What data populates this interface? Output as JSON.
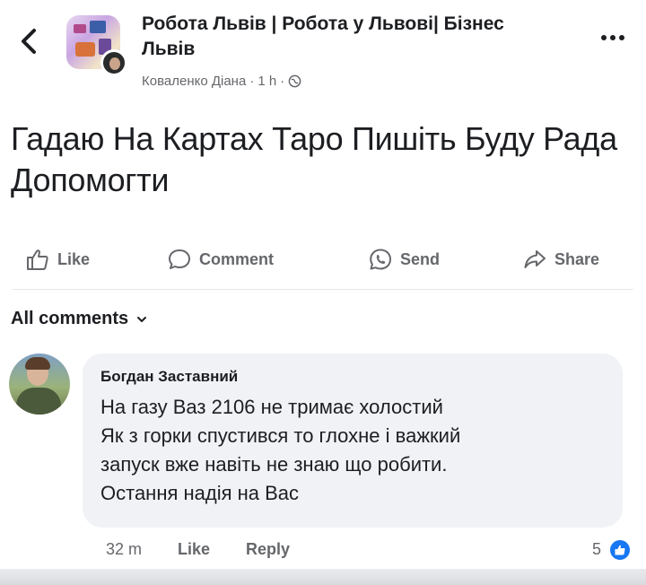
{
  "header": {
    "back_icon": "chevron-left-icon",
    "group_name": "Робота Львів | Робота у Львові| Бізнес Львів",
    "author": "Коваленко Діана",
    "separator": "·",
    "time": "1 h",
    "privacy_icon": "globe-icon",
    "more_icon": "more-horizontal-icon"
  },
  "post": {
    "text": "Гадаю На Картах Таро Пишіть Буду Рада Допомогти"
  },
  "actions": {
    "like_label": "Like",
    "comment_label": "Comment",
    "send_label": "Send",
    "share_label": "Share"
  },
  "comments_filter": {
    "label": "All comments"
  },
  "comment": {
    "author": "Богдан Заставний",
    "text": "На газу Ваз 2106 не тримає холостий\nЯк з горки спустився то глохне  і важкий\nзапуск вже навіть не знаю що робити.\nОстання надія на Вас",
    "time": "32 m",
    "like_label": "Like",
    "reply_label": "Reply",
    "reaction_count": "5"
  },
  "colors": {
    "text_primary": "#1c1e21",
    "text_secondary": "#65676b",
    "bubble_bg": "#f0f2f5",
    "accent_blue": "#1877f2"
  }
}
